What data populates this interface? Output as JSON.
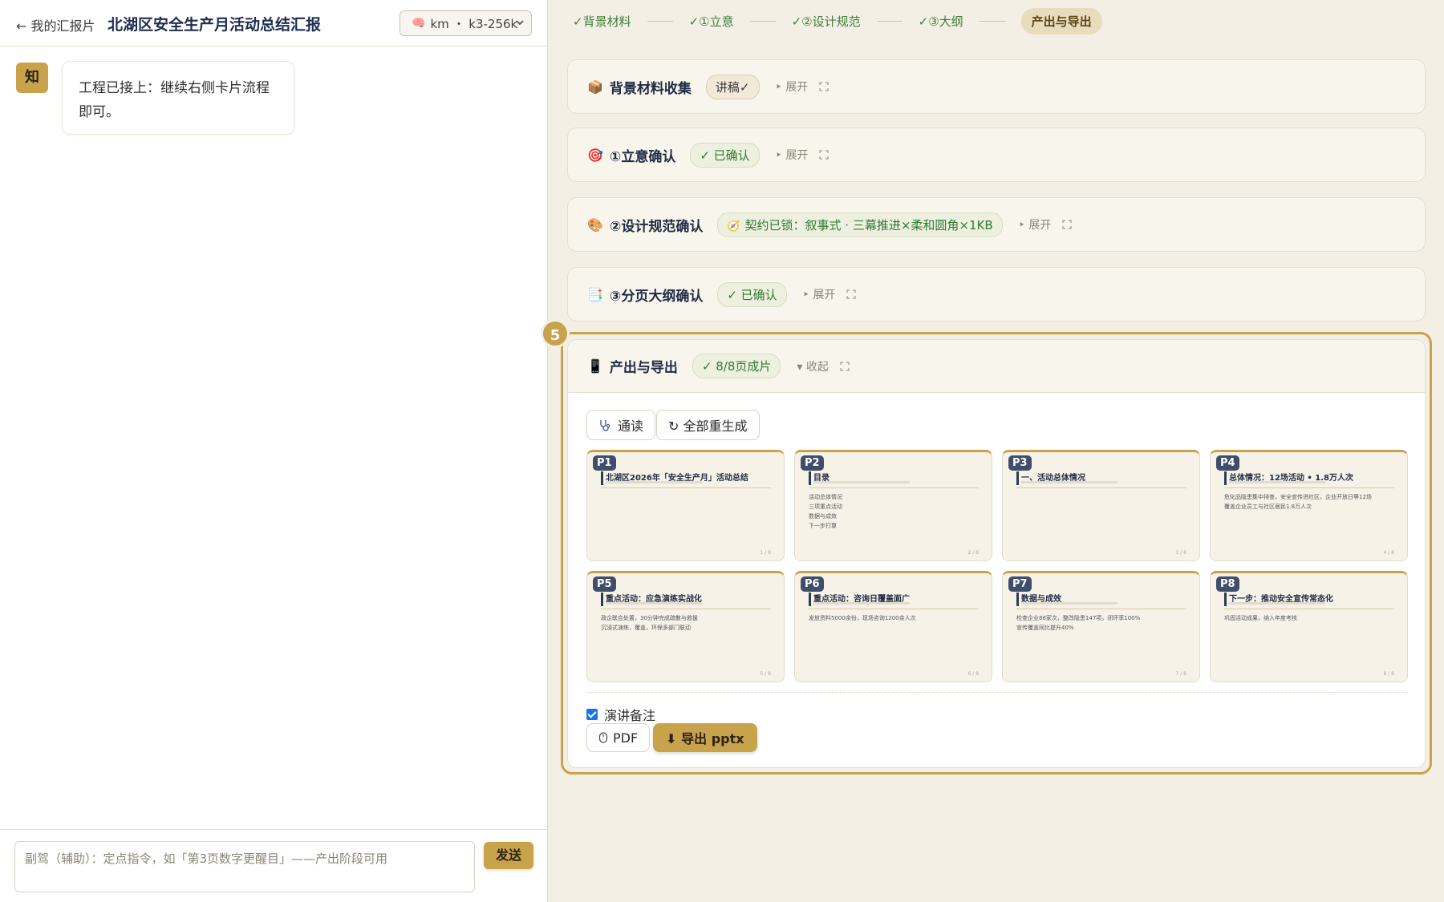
{
  "left": {
    "back_label": "← 我的汇报片",
    "doc_title": "北湖区安全生产月活动总结汇报",
    "model": {
      "icon": "brain-icon",
      "label": "km ・ k3-256k"
    },
    "messages": [
      {
        "avatar": "知",
        "text_line1": "工程已接上：继续右侧卡片流程",
        "text_line2": "即可。"
      }
    ],
    "input_placeholder": "副驾（辅助）：定点指令，如「第3页数字更醒目」——产出阶段可用",
    "send_label": "发送"
  },
  "stepper": {
    "steps": [
      {
        "label": "✓背景材料",
        "done": true
      },
      {
        "label": "✓①立意",
        "done": true
      },
      {
        "label": "✓②设计规范",
        "done": true
      },
      {
        "label": "✓③大纲",
        "done": true
      },
      {
        "label": "产出与导出",
        "done": false,
        "current": true
      }
    ]
  },
  "cards": [
    {
      "icon": "package-icon",
      "title": "背景材料收集",
      "pill": "讲稿✓",
      "pill_style": "neutral",
      "action": "‣ 展开"
    },
    {
      "icon": "target-icon",
      "title": "①立意确认",
      "pill": "✓ 已确认",
      "pill_style": "green",
      "action": "‣ 展开"
    },
    {
      "icon": "palette-icon",
      "title": "②设计规范确认",
      "pill": "契约已锁：叙事式 · 三幕推进×柔和圆角×1KB",
      "pill_style": "green",
      "action": "‣ 展开"
    },
    {
      "icon": "outline-icon",
      "title": "③分页大纲确认",
      "pill": "✓ 已确认",
      "pill_style": "green",
      "action": "‣ 展开"
    }
  ],
  "active": {
    "step_number": "5",
    "icon": "phone-icon",
    "title": "产出与导出",
    "pill": "✓ 8/8页成片",
    "action": "▾ 收起",
    "read_btn": "通读",
    "regen_btn": "↻ 全部重生成",
    "notes_label": "演讲备注",
    "notes_checked": true,
    "pdf_btn": "PDF",
    "export_btn": "⬇ 导出 pptx",
    "slides": [
      {
        "no": "P1",
        "title": "北湖区2026年「安全生产月」活动总结",
        "lines": [],
        "page": "1 / 8"
      },
      {
        "no": "P2",
        "title": "目录",
        "lines": [
          "活动总体情况",
          "三项重点活动",
          "数据与成效",
          "下一步打算"
        ],
        "page": "2 / 8"
      },
      {
        "no": "P3",
        "title": "一、活动总体情况",
        "lines": [],
        "page": "3 / 8"
      },
      {
        "no": "P4",
        "title": "总体情况：12场活动 • 1.8万人次",
        "lines": [
          "危化品隐患集中排查，安全宣传进社区，企业开放日等12场",
          "覆盖企业员工与社区居民1.8万人次"
        ],
        "page": "4 / 8"
      },
      {
        "no": "P5",
        "title": "重点活动：应急演练实战化",
        "lines": [
          "政企联合处置，30分钟完成疏散与救援",
          "沉浸式演练，覆盖，环保多部门联动"
        ],
        "page": "5 / 8"
      },
      {
        "no": "P6",
        "title": "重点活动：咨询日覆盖面广",
        "lines": [
          "发放资料5000余份，现场咨询1200余人次"
        ],
        "page": "6 / 8"
      },
      {
        "no": "P7",
        "title": "数据与成效",
        "lines": [
          "检查企业86家次，整改隐患147项，闭环率100%",
          "宣传覆盖同比提升40%"
        ],
        "page": "7 / 8"
      },
      {
        "no": "P8",
        "title": "下一步：推动安全宣传常态化",
        "lines": [
          "巩固活动成果，纳入年度考核"
        ],
        "page": "8 / 8"
      }
    ]
  },
  "colors": {
    "accent": "#c9a24c",
    "green": "#2f7a32",
    "navy": "#1f2a44",
    "bg": "#f3efe5"
  }
}
